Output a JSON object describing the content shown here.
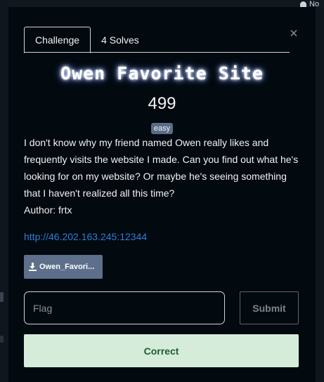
{
  "topbar": {
    "user_text": "No"
  },
  "tabs": [
    {
      "label": "Challenge",
      "active": true
    },
    {
      "label": "4 Solves",
      "active": false
    }
  ],
  "close_label": "×",
  "challenge": {
    "title": "Owen Favorite Site",
    "points": "499",
    "difficulty": "easy",
    "description": "I don't know why my friend named Owen really likes and frequently visits the website I made. Can you find out what he's looking for on my website? Or maybe he's seeing something that I haven't realized all this time?",
    "author": "Author: frtx",
    "link": "http://46.202.163.245:12344",
    "file_label": "Owen_Favori..."
  },
  "form": {
    "flag_placeholder": "Flag",
    "flag_value": "",
    "submit_label": "Submit",
    "result_text": "Correct"
  },
  "colors": {
    "background": "#02090f",
    "badge": "#5a6c86",
    "link": "#2e7dd8",
    "file_button": "#5d6f8a",
    "success_bg": "#d5ecdb",
    "success_text": "#1e5d30"
  }
}
